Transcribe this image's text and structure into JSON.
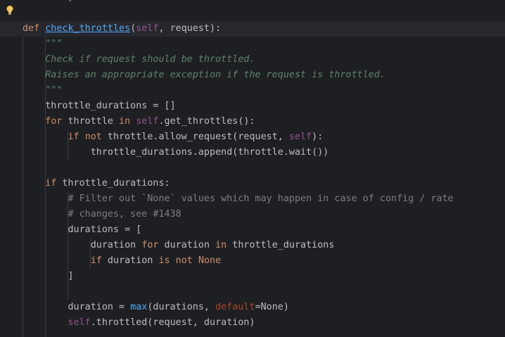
{
  "editor": {
    "intention_icon": "lightbulb-icon",
    "lines": [
      {
        "indent": "        ",
        "t1": ")"
      },
      {
        "kw_def": "def",
        "fn_name": "check_throttles",
        "open": "(",
        "self": "self",
        "rest": ", request):"
      },
      {
        "indent": "    ",
        "doc": "\"\"\""
      },
      {
        "indent": "    ",
        "doc": "Check if request should be throttled."
      },
      {
        "indent": "    ",
        "doc": "Raises an appropriate exception if the request is throttled."
      },
      {
        "indent": "    ",
        "doc": "\"\"\""
      },
      {
        "indent": "    ",
        "t1": "throttle_durations = []"
      },
      {
        "indent": "    ",
        "kw1": "for",
        "t1": " throttle ",
        "kw2": "in",
        "t2": " ",
        "self": "self",
        "t3": ".get_throttles():"
      },
      {
        "indent": "        ",
        "kw1": "if",
        "t1": " ",
        "kw2": "not",
        "t2": " throttle.allow_request(request, ",
        "self": "self",
        "t3": "):"
      },
      {
        "indent": "            ",
        "t1": "throttle_durations.append(throttle.wait())"
      },
      {
        "indent": "",
        "t1": ""
      },
      {
        "indent": "    ",
        "kw1": "if",
        "t1": " throttle_durations:"
      },
      {
        "indent": "        ",
        "cm": "# Filter out `None` values which may happen in case of config / rate"
      },
      {
        "indent": "        ",
        "cm": "# changes, see #1438"
      },
      {
        "indent": "        ",
        "t1": "durations = ["
      },
      {
        "indent": "            ",
        "t1": "duration ",
        "kw1": "for",
        "t2": " duration ",
        "kw2": "in",
        "t3": " throttle_durations"
      },
      {
        "indent": "            ",
        "kw1": "if",
        "t1": " duration ",
        "kw2": "is not",
        "t2": " ",
        "kw3": "None"
      },
      {
        "indent": "        ",
        "t1": "]"
      },
      {
        "indent": "",
        "t1": ""
      },
      {
        "indent": "        ",
        "t1": "duration = ",
        "fn": "max",
        "t2": "(durations, ",
        "param": "default",
        "t3": "=None)"
      },
      {
        "indent": "        ",
        "self": "self",
        "t1": ".throttled(request, duration)"
      }
    ]
  }
}
